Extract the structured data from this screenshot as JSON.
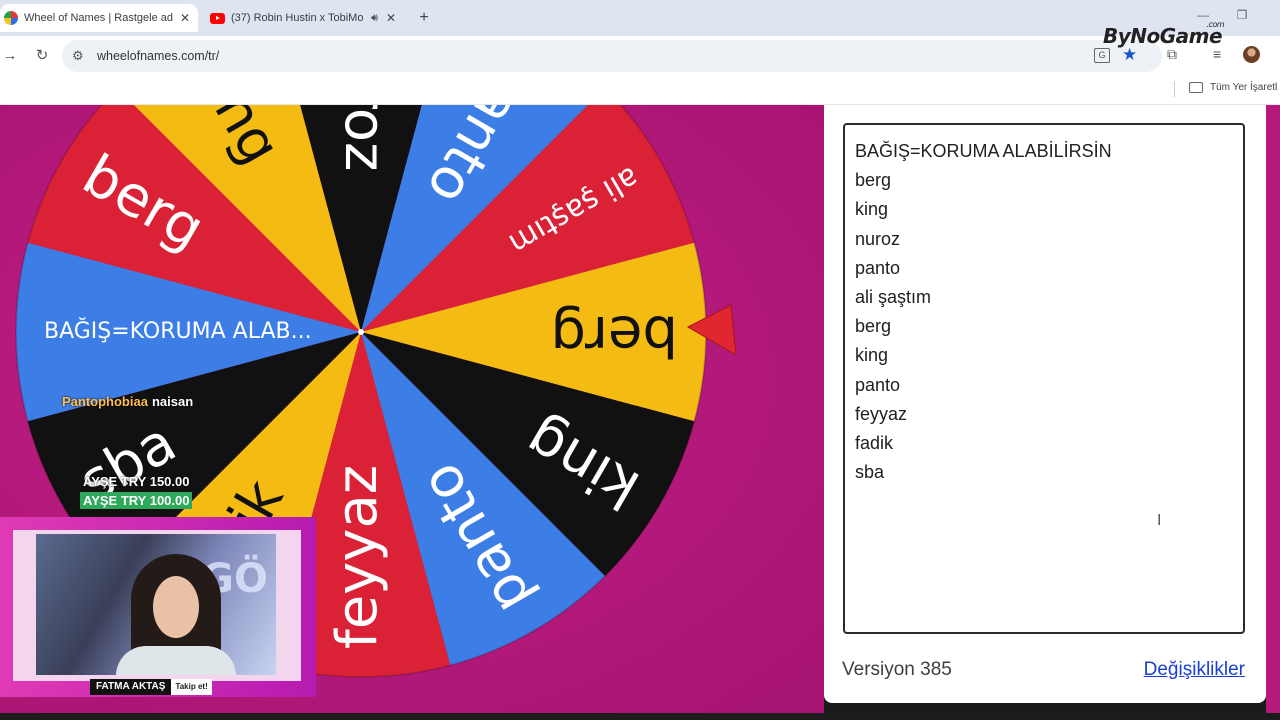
{
  "browser": {
    "tabs": [
      {
        "title": "Wheel of Names | Rastgele ad s",
        "active": true,
        "icon": "wheel-favicon-icon"
      },
      {
        "title": "(37) Robin Hustin x TobiMo",
        "active": false,
        "icon": "youtube-favicon-icon"
      }
    ],
    "url": "wheelofnames.com/tr/",
    "bookmarks_label": "Tüm Yer İşaretl",
    "watermark": "ByNoGame",
    "watermark_suffix": ".com"
  },
  "wheel": {
    "segments": [
      {
        "label": "BAĞIŞ=KORUMA ALAB...",
        "color": "#3d7ee6"
      },
      {
        "label": "berg",
        "color": "#db2136"
      },
      {
        "label": "king",
        "color": "#f4bc12"
      },
      {
        "label": "nuroz",
        "color": "#111111"
      },
      {
        "label": "panto",
        "color": "#3d7ee6"
      },
      {
        "label": "ali şaştım",
        "color": "#db2136"
      },
      {
        "label": "berg",
        "color": "#f4bc12"
      },
      {
        "label": "king",
        "color": "#111111"
      },
      {
        "label": "panto",
        "color": "#3d7ee6"
      },
      {
        "label": "feyyaz",
        "color": "#db2136"
      },
      {
        "label": "fadik",
        "color": "#f4bc12"
      },
      {
        "label": "sba",
        "color": "#111111"
      }
    ]
  },
  "overlay": {
    "chat_nick": "Pantophobiaa",
    "chat_msg": "naisan",
    "donations": [
      "AYŞE  TRY 150.00",
      "AYŞE  TRY 100.00"
    ],
    "streamer_name": "FATMA AKTAŞ",
    "follow_label": "Takip et!",
    "cam_bg_text": "GÖ"
  },
  "entries": [
    "BAĞIŞ=KORUMA ALABİLİRSİN",
    "berg",
    "king",
    "nuroz",
    "panto",
    "ali şaştım",
    "berg",
    "king",
    "panto",
    "feyyaz",
    "fadik",
    "sba"
  ],
  "footer": {
    "version": "Versiyon 385",
    "changes_link": "Değişiklikler"
  }
}
